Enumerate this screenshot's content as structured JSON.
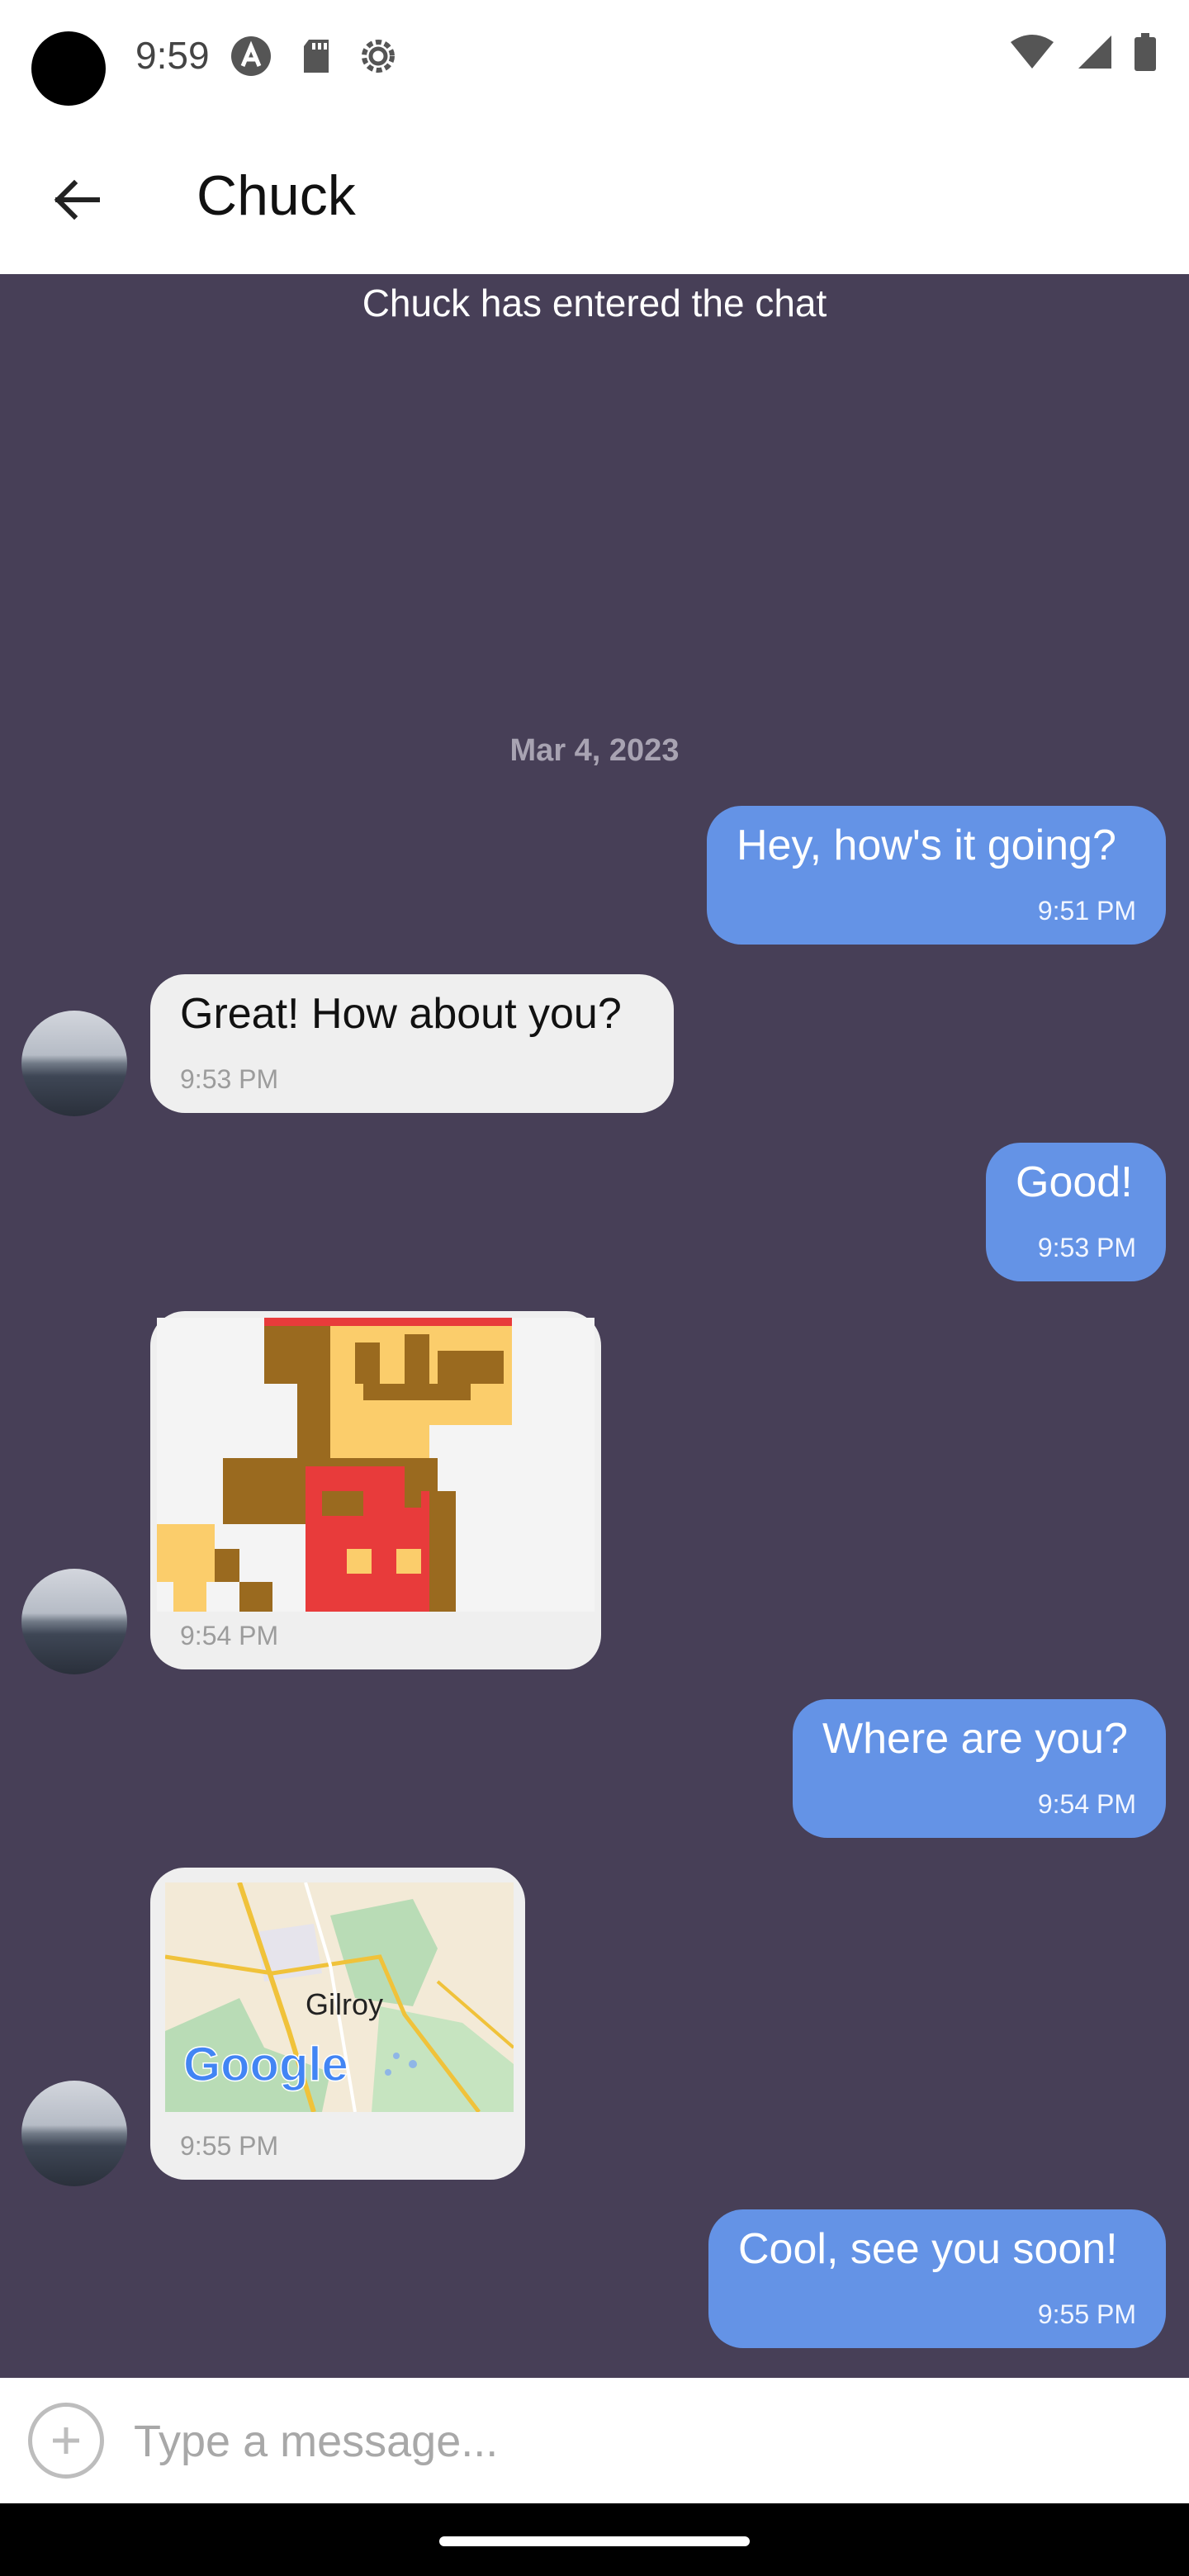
{
  "status_bar": {
    "time": "9:59",
    "icons": [
      "android-auto-icon",
      "sd-card-icon",
      "settings-gear-icon",
      "wifi-icon",
      "signal-icon",
      "battery-icon"
    ]
  },
  "header": {
    "title": "Chuck",
    "back_icon": "arrow-back-icon"
  },
  "chat": {
    "system_note": "Chuck has entered the chat",
    "date_separator": "Mar 4, 2023",
    "messages": [
      {
        "direction": "out",
        "type": "text",
        "text": "Hey, how's it going?",
        "time": "9:51 PM"
      },
      {
        "direction": "in",
        "type": "text",
        "text": "Great! How about you?",
        "time": "9:53 PM"
      },
      {
        "direction": "out",
        "type": "text",
        "text": "Good!",
        "time": "9:53 PM"
      },
      {
        "direction": "in",
        "type": "image",
        "time": "9:54 PM"
      },
      {
        "direction": "out",
        "type": "text",
        "text": "Where are you?",
        "time": "9:54 PM"
      },
      {
        "direction": "in",
        "type": "location",
        "place": "Gilroy",
        "map_brand": "Google",
        "time": "9:55 PM"
      },
      {
        "direction": "out",
        "type": "text",
        "text": "Cool, see you soon!",
        "time": "9:55 PM"
      }
    ]
  },
  "input": {
    "placeholder": "Type a message...",
    "value": ""
  },
  "colors": {
    "chat_background": "#473f57",
    "outgoing_bubble": "#6493e6",
    "incoming_bubble": "#efefef"
  }
}
